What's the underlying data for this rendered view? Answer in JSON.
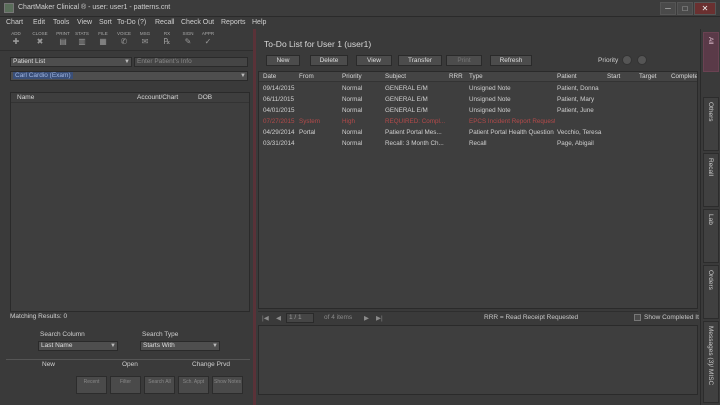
{
  "window": {
    "title": "ChartMaker Clinical ® - user: user1 - patterns.cnt",
    "min": "─",
    "max": "□",
    "close": "✕"
  },
  "menu": [
    "Chart",
    "Edit",
    "Tools",
    "View",
    "Sort",
    "To-Do (?)",
    "Recall",
    "Check Out",
    "Reports",
    "Help"
  ],
  "toolbar": {
    "items": [
      {
        "label": "ADD",
        "icon": "add-icon"
      },
      {
        "label": "CLOSE",
        "icon": "close-chart-icon"
      },
      {
        "label": "PRINT",
        "icon": "print-icon"
      },
      {
        "label": "STATS",
        "icon": "stats-icon"
      },
      {
        "label": "FILE",
        "icon": "file-icon"
      },
      {
        "label": "VOICE",
        "icon": "voice-icon"
      },
      {
        "label": "MSG",
        "icon": "message-icon"
      },
      {
        "label": "RX",
        "icon": "rx-icon"
      },
      {
        "label": "SIGN",
        "icon": "sign-icon"
      },
      {
        "label": "APPR",
        "icon": "approve-icon"
      }
    ],
    "glyphs": [
      "✚",
      "✖",
      "▤",
      "▥",
      "▦",
      "✆",
      "✉",
      "℞",
      "✎",
      "✓"
    ]
  },
  "left": {
    "patient_list_select": "Patient List",
    "search_placeholder": "Enter Patient's Info",
    "provider_select": "Carl Cardio (Exam)",
    "columns": [
      "Name",
      "Account/Chart",
      "DOB"
    ],
    "matching_results": "Matching Results: 0",
    "search_column_label": "Search Column",
    "search_column_value": "Last Name",
    "search_type_label": "Search Type",
    "search_type_value": "Starts With",
    "tabs": [
      "New",
      "Open",
      "Change Prvd"
    ],
    "buttons": [
      "Recent",
      "Filter",
      "Search All",
      "Sch. Appt",
      "Show Notes"
    ]
  },
  "todo": {
    "title": "To-Do List for User 1 (user1)",
    "buttons": [
      "New",
      "Delete",
      "View",
      "Transfer",
      "Print",
      "Refresh"
    ],
    "priority_label": "Priority",
    "columns": [
      "Date",
      "From",
      "Priority",
      "Subject",
      "RRR",
      "Type",
      "Patient",
      "Start",
      "Target",
      "Complete"
    ],
    "rows": [
      {
        "date": "09/14/2015",
        "from": "",
        "priority": "Normal",
        "subject": "GENERAL E/M",
        "rrr": "",
        "type": "Unsigned Note",
        "patient": "Patient, Donna",
        "red": false
      },
      {
        "date": "06/11/2015",
        "from": "",
        "priority": "Normal",
        "subject": "GENERAL E/M",
        "rrr": "",
        "type": "Unsigned Note",
        "patient": "Patient, Mary",
        "red": false
      },
      {
        "date": "04/01/2015",
        "from": "",
        "priority": "Normal",
        "subject": "GENERAL E/M",
        "rrr": "",
        "type": "Unsigned Note",
        "patient": "Patient, June",
        "red": false
      },
      {
        "date": "07/27/2015",
        "from": "System",
        "priority": "High",
        "subject": "REQUIRED: Compl...",
        "rrr": "",
        "type": "EPCS Incident Report Requested",
        "patient": "",
        "red": true
      },
      {
        "date": "04/29/2014",
        "from": "Portal",
        "priority": "Normal",
        "subject": "Patient Portal Mes...",
        "rrr": "",
        "type": "Patient Portal Health Question",
        "patient": "Vecchio, Teresa",
        "red": false
      },
      {
        "date": "03/31/2014",
        "from": "",
        "priority": "Normal",
        "subject": "Recall: 3 Month Ch...",
        "rrr": "",
        "type": "Recall",
        "patient": "Page, Abigail",
        "red": false
      }
    ],
    "pager": {
      "first": "|◀",
      "prev": "◀",
      "page_value": "1 / 1",
      "of_text": "of 4 items",
      "next": "▶",
      "last": "▶|",
      "legend": "RRR = Read Receipt Requested",
      "show_completed": "Show Completed It"
    }
  },
  "side_tabs": [
    "All",
    "Others",
    "Recall",
    "Lab",
    "Orders",
    "Messages (3)/ MISC"
  ]
}
